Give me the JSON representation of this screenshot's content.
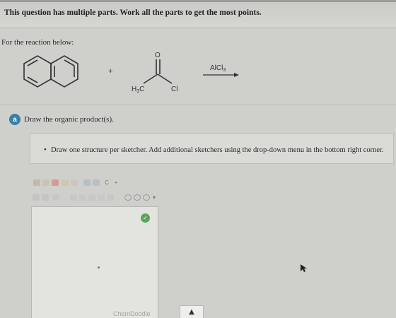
{
  "question": {
    "heading": "This question has multiple parts. Work all the parts to get the most points.",
    "instruction": "For the reaction below:"
  },
  "reaction": {
    "plus": "+",
    "reagent_prefix": "AlCl",
    "reagent_subscript": "3",
    "acyl_oxygen": "O",
    "acyl_methyl": "H",
    "acyl_methyl_subscript": "3",
    "acyl_methyl_suffix": "C",
    "acyl_chloride": "Cl"
  },
  "part": {
    "number": "a",
    "prompt": "Draw the organic product(s)."
  },
  "hint": {
    "bullet": "•",
    "text": "Draw one structure per sketcher. Add additional sketchers using the drop-down menu in the bottom right corner."
  },
  "sketcher": {
    "brand": "ChemDoodle",
    "status_icon": "✓",
    "menu_button": "▲",
    "tool_text_symbol": "+",
    "tool_charge": "C",
    "tool_ring_select": "▾"
  },
  "colors": {
    "badge": "#3b7fa8",
    "status": "#5aa55c",
    "panel": "#dadbd7"
  }
}
